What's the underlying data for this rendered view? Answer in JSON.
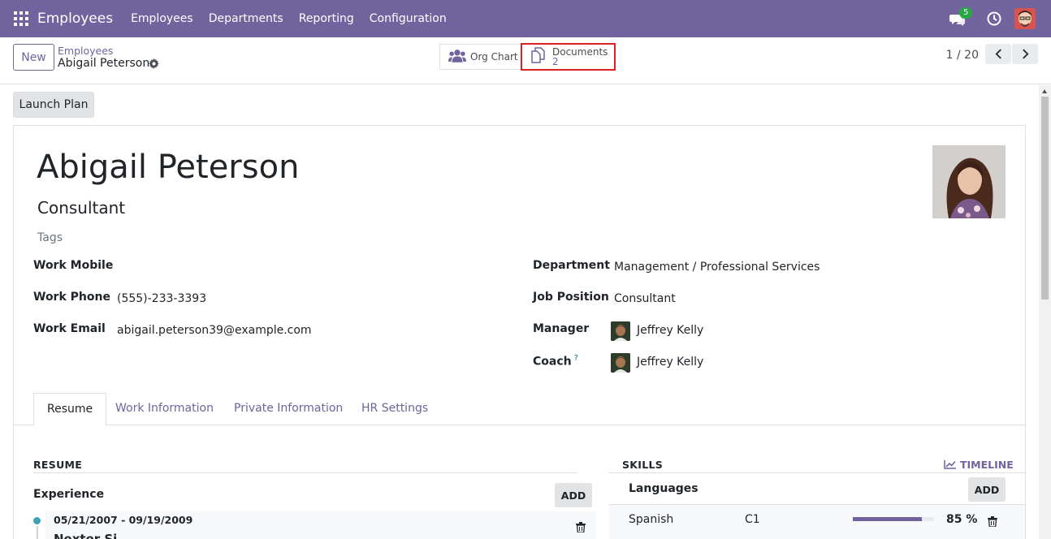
{
  "navbar": {
    "brand": "Employees",
    "menu": [
      "Employees",
      "Departments",
      "Reporting",
      "Configuration"
    ],
    "chat_badge": "5"
  },
  "control": {
    "new_label": "New",
    "breadcrumb_parent": "Employees",
    "breadcrumb_current": "Abigail Peterson",
    "org_chart_label": "Org Chart",
    "documents_label": "Documents",
    "documents_count": "2",
    "pager": "1 / 20"
  },
  "actions": {
    "launch_plan": "Launch Plan"
  },
  "employee": {
    "name": "Abigail Peterson",
    "job_title": "Consultant",
    "tags_placeholder": "Tags",
    "fields_left": [
      {
        "label": "Work Mobile",
        "value": ""
      },
      {
        "label": "Work Phone",
        "value": "(555)-233-3393"
      },
      {
        "label": "Work Email",
        "value": "abigail.peterson39@example.com"
      }
    ],
    "fields_right": [
      {
        "label": "Department",
        "value": "Management / Professional Services"
      },
      {
        "label": "Job Position",
        "value": "Consultant"
      },
      {
        "label": "Manager",
        "value": "Jeffrey Kelly"
      },
      {
        "label": "Coach",
        "value": "Jeffrey Kelly",
        "help": "?"
      }
    ]
  },
  "tabs": [
    "Resume",
    "Work Information",
    "Private Information",
    "HR Settings"
  ],
  "resume": {
    "title": "RESUME",
    "experience_label": "Experience",
    "add_label": "ADD",
    "entries": [
      {
        "date": "05/21/2007 - 09/19/2009",
        "name": "Nexter Si..."
      }
    ]
  },
  "skills": {
    "title": "SKILLS",
    "timeline_label": "TIMELINE",
    "add_label": "ADD",
    "groups": [
      {
        "type": "Languages",
        "rows": [
          {
            "skill": "Spanish",
            "level": "C1",
            "progress": 85,
            "progress_label": "85 %"
          }
        ]
      }
    ]
  },
  "colors": {
    "brand": "#71639e",
    "highlight": "#e02020",
    "badge": "#28a745"
  }
}
